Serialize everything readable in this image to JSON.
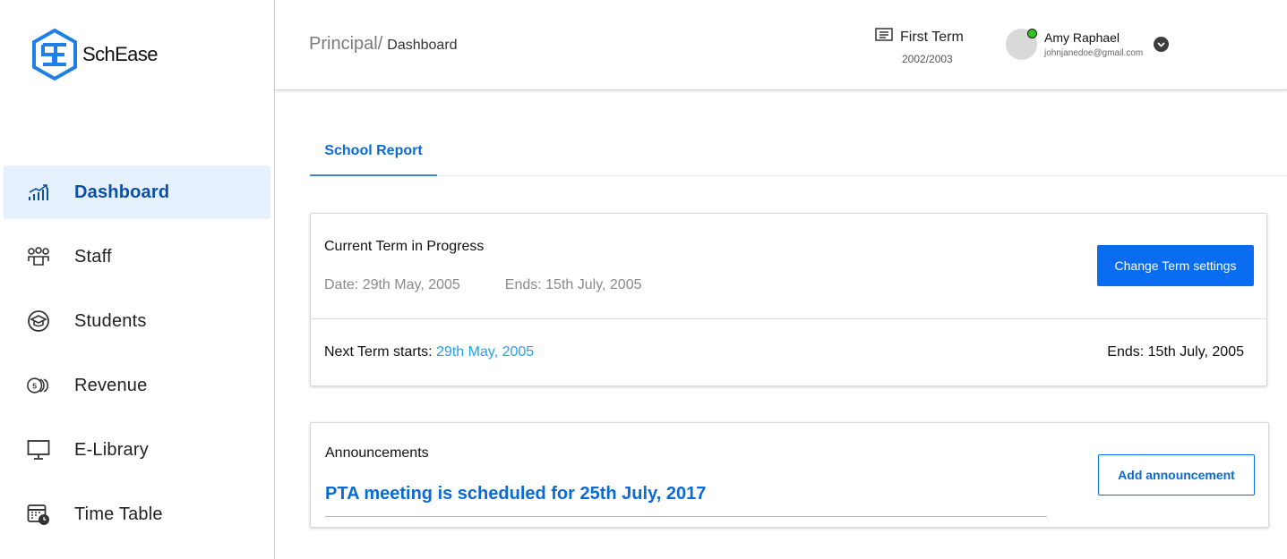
{
  "app": {
    "name": "SchEase",
    "colors": {
      "accent": "#0a6cf0",
      "active_bg": "#e6f0fc",
      "link": "#1ea3e8",
      "online": "#2ec51f"
    }
  },
  "sidebar": {
    "items": [
      {
        "label": "Dashboard",
        "icon": "chart-icon",
        "active": true
      },
      {
        "label": "Staff",
        "icon": "staff-icon",
        "active": false
      },
      {
        "label": "Students",
        "icon": "graduation-cap-icon",
        "active": false
      },
      {
        "label": "Revenue",
        "icon": "coins-icon",
        "active": false
      },
      {
        "label": "E-Library",
        "icon": "monitor-icon",
        "active": false
      },
      {
        "label": "Time Table",
        "icon": "calendar-clock-icon",
        "active": false
      }
    ]
  },
  "header": {
    "breadcrumb_root": "Principal/",
    "breadcrumb_current": "Dashboard",
    "term_name": "First Term",
    "term_year": "2002/2003",
    "user_name": "Amy Raphael",
    "user_email": "johnjanedoe@gmail.com"
  },
  "tabs": [
    {
      "label": "School Report",
      "active": true
    }
  ],
  "current_term": {
    "title": "Current Term in Progress",
    "date": "Date: 29th May, 2005",
    "ends": "Ends: 15th July, 2005",
    "button": "Change Term settings",
    "next_label": "Next Term starts: ",
    "next_date": "29th May, 2005",
    "next_ends": "Ends: 15th July, 2005"
  },
  "announcements": {
    "title": "Announcements",
    "items": [
      "PTA meeting is scheduled for 25th July, 2017"
    ],
    "button": "Add announcement"
  }
}
